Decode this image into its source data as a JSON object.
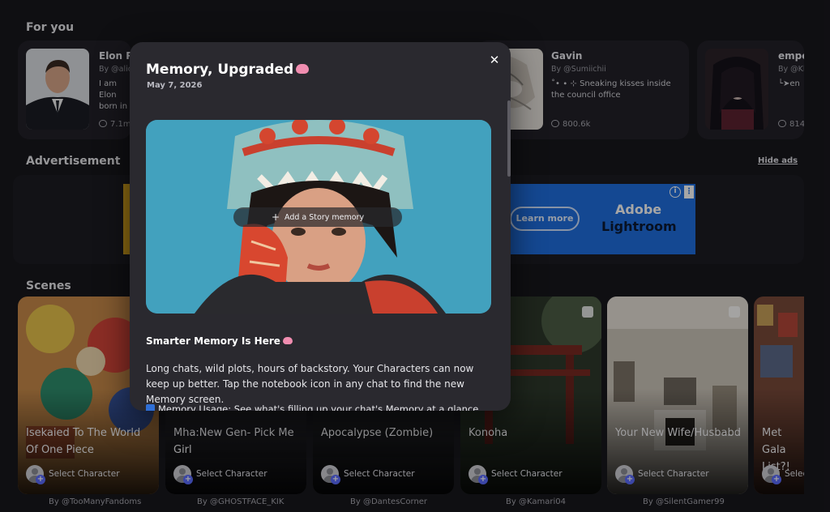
{
  "for_you": {
    "title": "For you",
    "cards": [
      {
        "name": "Elon Re",
        "by": "By @alic",
        "desc": "I am Elon born in J South A",
        "count": "7.1m"
      },
      {
        "name": "Gavin",
        "by": "By @Sumiichii",
        "desc": "˚• ∙ ⊹ Sneaking kisses inside the council office",
        "count": "800.6k"
      },
      {
        "name": "empe",
        "by": "By @Kl",
        "desc": "└➤en",
        "count": "814"
      }
    ]
  },
  "advertisement": {
    "title": "Advertisement",
    "hide_label": "Hide ads",
    "learn_more": "Learn more",
    "brand_line1": "Adobe",
    "brand_line2": "Lightroom",
    "info_glyph": "i",
    "menu_glyph": "⋮"
  },
  "scenes": {
    "title": "Scenes",
    "select_label": "Select Character",
    "items": [
      {
        "title": "Isekaied To The World Of One Piece",
        "by": "By @TooManyFandoms"
      },
      {
        "title": "Mha:New Gen- Pick Me Girl",
        "by": "By @GHOSTFACE_KIK"
      },
      {
        "title": "Apocalypse (Zombie)",
        "by": "By @DantesCorner"
      },
      {
        "title": "Konoha",
        "by": "By @Kamari04"
      },
      {
        "title": "Your New Wife/Husbabd",
        "by": "By @SilentGamer99"
      },
      {
        "title": "Met Gala List?!",
        "by": ""
      }
    ]
  },
  "modal": {
    "title": "Memory, Upgraded",
    "date": "May 7, 2026",
    "close_glyph": "✕",
    "story_button": "Add a Story memory",
    "smart_heading": "Smarter Memory Is Here",
    "body": "Long chats, wild plots, hours of backstory. Your Characters can now keep up better. Tap the notebook icon in any chat to find the new Memory screen.",
    "usage_line": "Memory Usage: See what's filling up your chat's Memory at a glance."
  },
  "colors": {
    "background": "#18171d",
    "modal": "#2a292f",
    "ad_blue": "#1f6fe0",
    "accent": "#5b6cff"
  }
}
